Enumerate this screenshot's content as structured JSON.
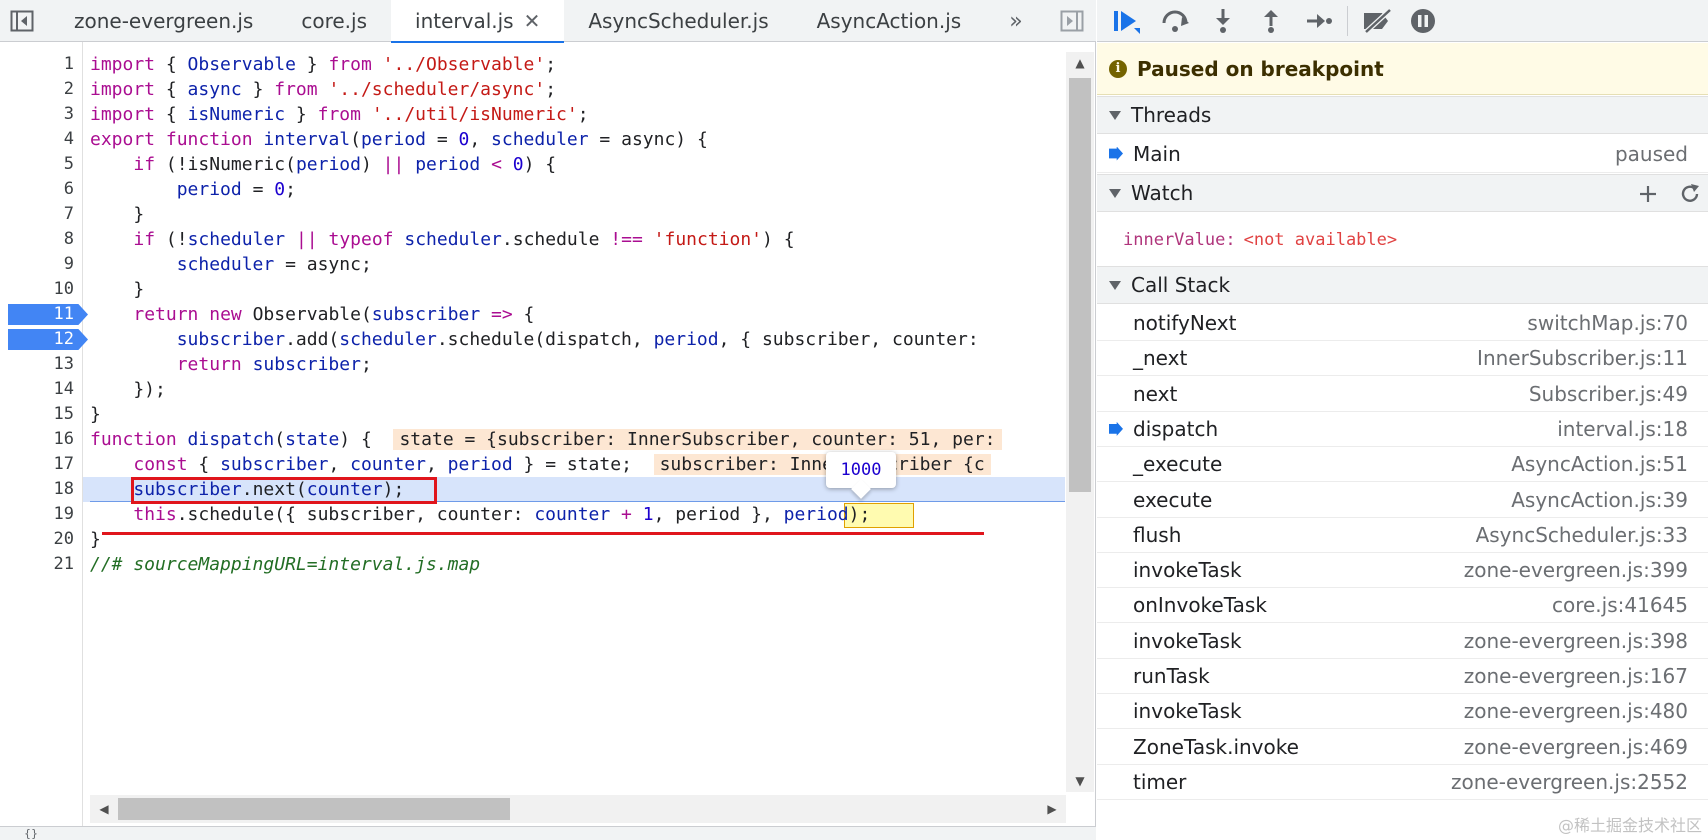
{
  "editor": {
    "tabs": [
      {
        "label": "zone-evergreen.js",
        "active": false
      },
      {
        "label": "core.js",
        "active": false
      },
      {
        "label": "interval.js",
        "active": true
      },
      {
        "label": "AsyncScheduler.js",
        "active": false
      },
      {
        "label": "AsyncAction.js",
        "active": false
      }
    ],
    "tab_close_glyph": "✕",
    "more_tabs_glyph": "»",
    "line_numbers": [
      "1",
      "2",
      "3",
      "4",
      "5",
      "6",
      "7",
      "8",
      "9",
      "10",
      "11",
      "12",
      "13",
      "14",
      "15",
      "16",
      "17",
      "18",
      "19",
      "20",
      "21"
    ],
    "breakpoint_lines": [
      "11",
      "12"
    ],
    "current_line": "18",
    "tooltip_value": "1000",
    "status_text": "{}"
  },
  "debugger": {
    "paused_message": "Paused on breakpoint",
    "threads": {
      "title": "Threads",
      "items": [
        {
          "name": "Main",
          "status": "paused"
        }
      ]
    },
    "watch": {
      "title": "Watch",
      "expressions": [
        {
          "name": "innerValue:",
          "value": "<not available>"
        }
      ]
    },
    "call_stack": {
      "title": "Call Stack",
      "frames": [
        {
          "fn": "notifyNext",
          "loc": "switchMap.js:70",
          "current": false
        },
        {
          "fn": "_next",
          "loc": "InnerSubscriber.js:11",
          "current": false
        },
        {
          "fn": "next",
          "loc": "Subscriber.js:49",
          "current": false
        },
        {
          "fn": "dispatch",
          "loc": "interval.js:18",
          "current": true
        },
        {
          "fn": "_execute",
          "loc": "AsyncAction.js:51",
          "current": false
        },
        {
          "fn": "execute",
          "loc": "AsyncAction.js:39",
          "current": false
        },
        {
          "fn": "flush",
          "loc": "AsyncScheduler.js:33",
          "current": false
        },
        {
          "fn": "invokeTask",
          "loc": "zone-evergreen.js:399",
          "current": false
        },
        {
          "fn": "onInvokeTask",
          "loc": "core.js:41645",
          "current": false
        },
        {
          "fn": "invokeTask",
          "loc": "zone-evergreen.js:398",
          "current": false
        },
        {
          "fn": "runTask",
          "loc": "zone-evergreen.js:167",
          "current": false
        },
        {
          "fn": "invokeTask",
          "loc": "zone-evergreen.js:480",
          "current": false
        },
        {
          "fn": "ZoneTask.invoke",
          "loc": "zone-evergreen.js:469",
          "current": false
        },
        {
          "fn": "timer",
          "loc": "zone-evergreen.js:2552",
          "current": false
        }
      ]
    },
    "watermark": "@稀土掘金技术社区"
  },
  "code": {
    "lines": [
      [
        [
          "kw",
          "import"
        ],
        [
          "p",
          " { "
        ],
        [
          "id",
          "Observable"
        ],
        [
          "p",
          " } "
        ],
        [
          "kw",
          "from"
        ],
        [
          "p",
          " "
        ],
        [
          "st",
          "'../Observable'"
        ],
        [
          "p",
          ";"
        ]
      ],
      [
        [
          "kw",
          "import"
        ],
        [
          "p",
          " { "
        ],
        [
          "id",
          "async"
        ],
        [
          "p",
          " } "
        ],
        [
          "kw",
          "from"
        ],
        [
          "p",
          " "
        ],
        [
          "st",
          "'../scheduler/async'"
        ],
        [
          "p",
          ";"
        ]
      ],
      [
        [
          "kw",
          "import"
        ],
        [
          "p",
          " { "
        ],
        [
          "id",
          "isNumeric"
        ],
        [
          "p",
          " } "
        ],
        [
          "kw",
          "from"
        ],
        [
          "p",
          " "
        ],
        [
          "st",
          "'../util/isNumeric'"
        ],
        [
          "p",
          ";"
        ]
      ],
      [
        [
          "kw",
          "export"
        ],
        [
          "p",
          " "
        ],
        [
          "kw",
          "function"
        ],
        [
          "p",
          " "
        ],
        [
          "id",
          "interval"
        ],
        [
          "p",
          "("
        ],
        [
          "id",
          "period"
        ],
        [
          "p",
          " = "
        ],
        [
          "nm",
          "0"
        ],
        [
          "p",
          ", "
        ],
        [
          "id",
          "scheduler"
        ],
        [
          "p",
          " = async) {"
        ]
      ],
      [
        [
          "p",
          "    "
        ],
        [
          "kw",
          "if"
        ],
        [
          "p",
          " (!isNumeric("
        ],
        [
          "id",
          "period"
        ],
        [
          "p",
          ") "
        ],
        [
          "op",
          "||"
        ],
        [
          "p",
          " "
        ],
        [
          "id",
          "period"
        ],
        [
          "p",
          " "
        ],
        [
          "op",
          "<"
        ],
        [
          "p",
          " "
        ],
        [
          "nm",
          "0"
        ],
        [
          "p",
          ") {"
        ]
      ],
      [
        [
          "p",
          "        "
        ],
        [
          "id",
          "period"
        ],
        [
          "p",
          " = "
        ],
        [
          "nm",
          "0"
        ],
        [
          "p",
          ";"
        ]
      ],
      [
        [
          "p",
          "    }"
        ]
      ],
      [
        [
          "p",
          "    "
        ],
        [
          "kw",
          "if"
        ],
        [
          "p",
          " (!"
        ],
        [
          "id",
          "scheduler"
        ],
        [
          "p",
          " "
        ],
        [
          "op",
          "||"
        ],
        [
          "p",
          " "
        ],
        [
          "kw",
          "typeof"
        ],
        [
          "p",
          " "
        ],
        [
          "id",
          "scheduler"
        ],
        [
          "p",
          ".schedule "
        ],
        [
          "op",
          "!=="
        ],
        [
          "p",
          " "
        ],
        [
          "st",
          "'function'"
        ],
        [
          "p",
          ") {"
        ]
      ],
      [
        [
          "p",
          "        "
        ],
        [
          "id",
          "scheduler"
        ],
        [
          "p",
          " = async;"
        ]
      ],
      [
        [
          "p",
          "    }"
        ]
      ],
      [
        [
          "p",
          "    "
        ],
        [
          "kw",
          "return"
        ],
        [
          "p",
          " "
        ],
        [
          "kw",
          "new"
        ],
        [
          "p",
          " Observable("
        ],
        [
          "id",
          "subscriber"
        ],
        [
          "p",
          " "
        ],
        [
          "op",
          "=>"
        ],
        [
          "p",
          " {"
        ]
      ],
      [
        [
          "p",
          "        "
        ],
        [
          "id",
          "subscriber"
        ],
        [
          "p",
          ".add("
        ],
        [
          "id",
          "scheduler"
        ],
        [
          "p",
          ".schedule(dispatch, "
        ],
        [
          "id",
          "period"
        ],
        [
          "p",
          ", { subscriber, counter: "
        ]
      ],
      [
        [
          "p",
          "        "
        ],
        [
          "kw",
          "return"
        ],
        [
          "p",
          " "
        ],
        [
          "id",
          "subscriber"
        ],
        [
          "p",
          ";"
        ]
      ],
      [
        [
          "p",
          "    });"
        ]
      ],
      [
        [
          "p",
          "}"
        ]
      ],
      [
        [
          "kw",
          "function"
        ],
        [
          "p",
          " "
        ],
        [
          "id",
          "dispatch"
        ],
        [
          "p",
          "("
        ],
        [
          "id",
          "state"
        ],
        [
          "p",
          ") {  "
        ],
        [
          "iv",
          "state = {subscriber: InnerSubscriber, counter: 51, per:"
        ]
      ],
      [
        [
          "p",
          "    "
        ],
        [
          "kw",
          "const"
        ],
        [
          "p",
          " { "
        ],
        [
          "id",
          "subscriber"
        ],
        [
          "p",
          ", "
        ],
        [
          "id",
          "counter"
        ],
        [
          "p",
          ", "
        ],
        [
          "id",
          "period"
        ],
        [
          "p",
          " } = state;  "
        ],
        [
          "iv",
          "subscriber: InnerSubscriber {c"
        ]
      ],
      [
        [
          "p",
          "    "
        ],
        [
          "id",
          "subscriber"
        ],
        [
          "p",
          ".next("
        ],
        [
          "id",
          "counter"
        ],
        [
          "p",
          ");"
        ]
      ],
      [
        [
          "p",
          "    "
        ],
        [
          "kw",
          "this"
        ],
        [
          "p",
          ".schedule({ subscriber, counter: "
        ],
        [
          "id",
          "counter"
        ],
        [
          "p",
          " "
        ],
        [
          "op",
          "+"
        ],
        [
          "p",
          " "
        ],
        [
          "nm",
          "1"
        ],
        [
          "p",
          ", period }, "
        ],
        [
          "id",
          "period"
        ],
        [
          "p",
          ");"
        ]
      ],
      [
        [
          "p",
          "}"
        ]
      ],
      [
        [
          "cm",
          "//# sourceMappingURL=interval.js.map"
        ]
      ]
    ]
  }
}
